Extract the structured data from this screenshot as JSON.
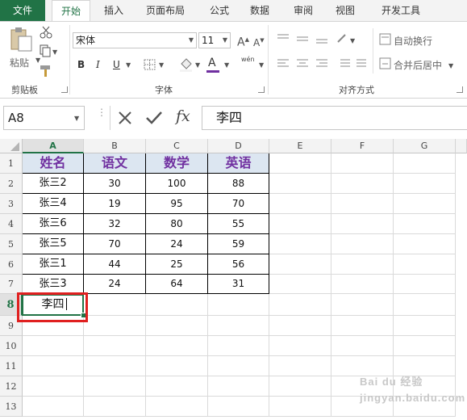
{
  "tabs": [
    "文件",
    "开始",
    "插入",
    "页面布局",
    "公式",
    "数据",
    "审阅",
    "视图",
    "开发工具"
  ],
  "ribbon": {
    "paste_label": "粘贴",
    "font_name": "宋体",
    "font_size": "11",
    "bold": "B",
    "italic": "I",
    "underline": "U",
    "font_color_glyph": "A",
    "wen_label": "wén",
    "wrap_text": "自动换行",
    "merge_center": "合并后居中",
    "group_clipboard": "剪贴板",
    "group_font": "字体",
    "group_alignment": "对齐方式"
  },
  "formula_bar": {
    "name_box": "A8",
    "content": "李四",
    "fx": "fx"
  },
  "columns": [
    "A",
    "B",
    "C",
    "D",
    "E",
    "F",
    "G"
  ],
  "rows": [
    "1",
    "2",
    "3",
    "4",
    "5",
    "6",
    "7",
    "8",
    "9",
    "10",
    "11",
    "12",
    "13"
  ],
  "table": {
    "headers": [
      "姓名",
      "语文",
      "数学",
      "英语"
    ],
    "rows": [
      [
        "张三2",
        "30",
        "100",
        "88"
      ],
      [
        "张三4",
        "19",
        "95",
        "70"
      ],
      [
        "张三6",
        "32",
        "80",
        "55"
      ],
      [
        "张三5",
        "70",
        "24",
        "59"
      ],
      [
        "张三1",
        "44",
        "25",
        "56"
      ],
      [
        "张三3",
        "24",
        "64",
        "31"
      ]
    ]
  },
  "editing_cell": "李四",
  "watermark": "Bai du 经验 jingyan.baidu.com",
  "colors": {
    "accent": "#217346",
    "header_fill": "#dce6f1",
    "header_text": "#7030a0",
    "highlight": "#e02020"
  }
}
